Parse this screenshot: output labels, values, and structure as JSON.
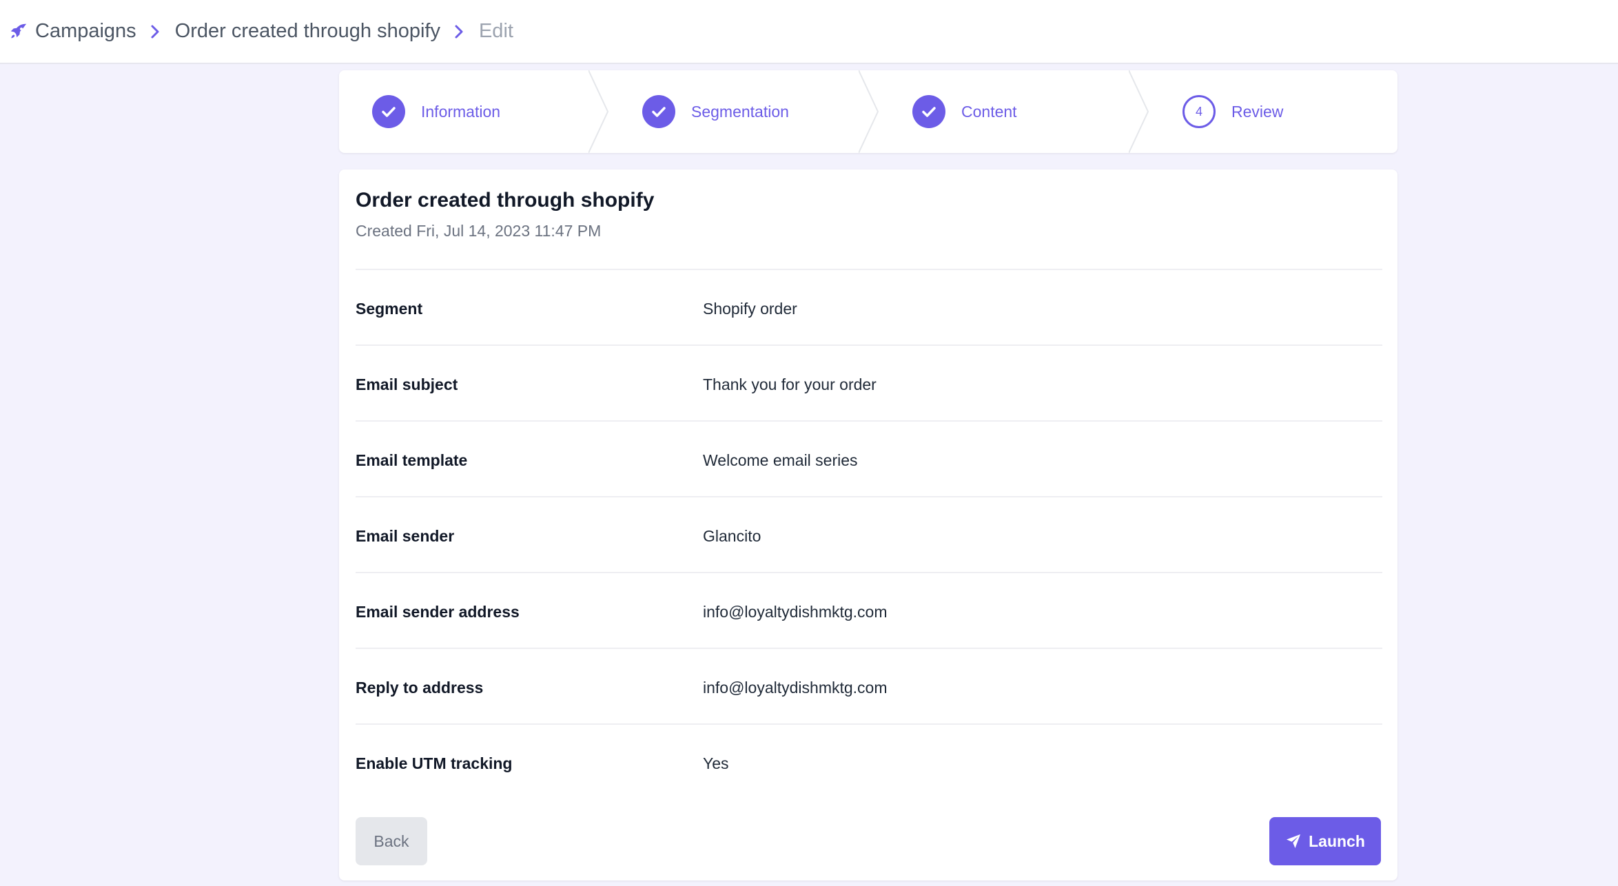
{
  "breadcrumb": {
    "icon": "rocket-icon",
    "items": [
      "Campaigns",
      "Order created through shopify",
      "Edit"
    ]
  },
  "steps": [
    {
      "label": "Information",
      "status": "complete"
    },
    {
      "label": "Segmentation",
      "status": "complete"
    },
    {
      "label": "Content",
      "status": "complete"
    },
    {
      "label": "Review",
      "status": "current",
      "number": "4"
    }
  ],
  "campaign": {
    "title": "Order created through shopify",
    "created": "Created Fri, Jul 14, 2023 11:47 PM"
  },
  "details": [
    {
      "key": "Segment",
      "value": "Shopify order"
    },
    {
      "key": "Email subject",
      "value": "Thank you for your order"
    },
    {
      "key": "Email template",
      "value": "Welcome email series"
    },
    {
      "key": "Email sender",
      "value": "Glancito"
    },
    {
      "key": "Email sender address",
      "value": "info@loyaltydishmktg.com"
    },
    {
      "key": "Reply to address",
      "value": "info@loyaltydishmktg.com"
    },
    {
      "key": "Enable UTM tracking",
      "value": "Yes"
    }
  ],
  "actions": {
    "back_label": "Back",
    "launch_label": "Launch",
    "launch_icon": "paper-plane-icon"
  },
  "colors": {
    "accent": "#6c5ce7",
    "page_background": "#f3f2fd"
  }
}
